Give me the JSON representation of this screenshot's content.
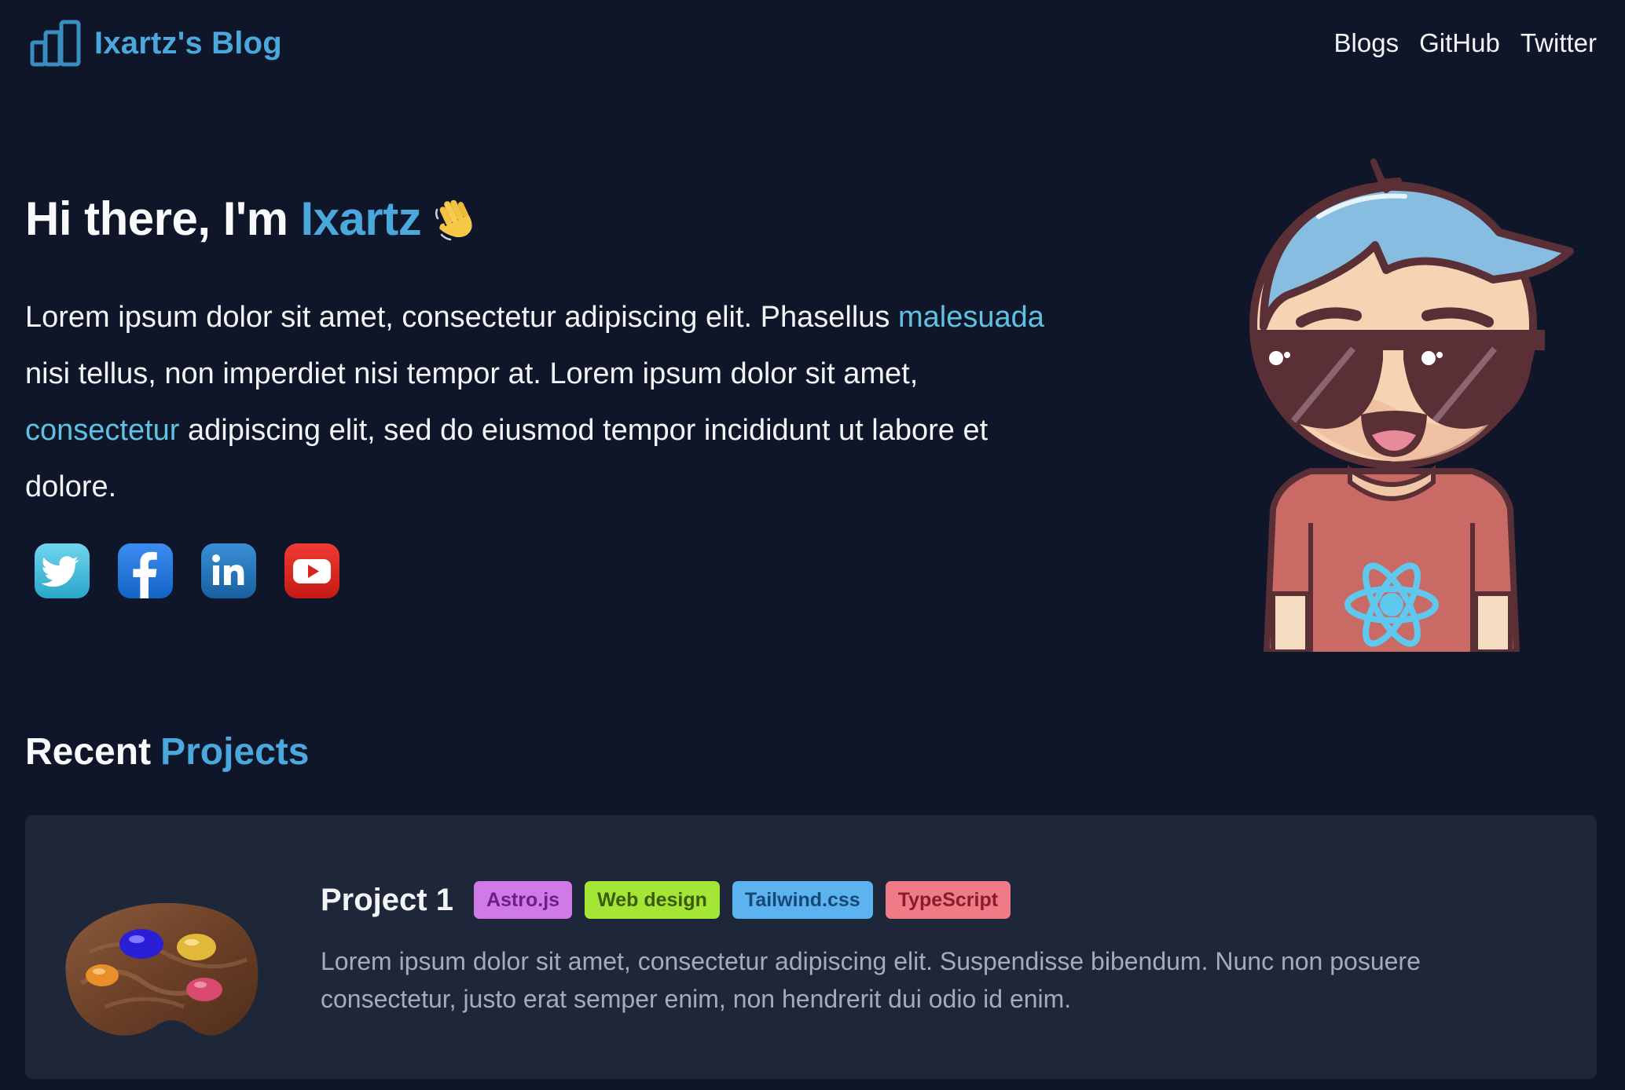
{
  "header": {
    "brand": "Ixartz's Blog",
    "nav": [
      {
        "label": "Blogs"
      },
      {
        "label": "GitHub"
      },
      {
        "label": "Twitter"
      }
    ]
  },
  "hero": {
    "greeting": "Hi there, I'm",
    "name": "Ixartz",
    "wave_icon": "waving-hand-icon",
    "paragraph": {
      "part1": "Lorem ipsum dolor sit amet, consectetur adipiscing elit. Phasellus ",
      "link1": "malesuada",
      "part2": " nisi tellus, non imperdiet nisi tempor at. Lorem ipsum dolor sit amet, ",
      "link2": "consectetur",
      "part3": " adipiscing elit, sed do eiusmod tempor incididunt ut labore et dolore."
    },
    "socials": [
      {
        "icon": "twitter-icon"
      },
      {
        "icon": "facebook-icon"
      },
      {
        "icon": "linkedin-icon"
      },
      {
        "icon": "youtube-icon"
      }
    ],
    "avatar_icon": "avatar-illustration"
  },
  "projects": {
    "title_part1": "Recent",
    "title_part2": "Projects",
    "items": [
      {
        "title": "Project 1",
        "image_icon": "paint-palette-icon",
        "tags": [
          {
            "label": "Astro.js",
            "bg": "#d07ae8",
            "fg": "#6b1f86"
          },
          {
            "label": "Web design",
            "bg": "#a3e635",
            "fg": "#3b5a0e"
          },
          {
            "label": "Tailwind.css",
            "bg": "#5cb3f0",
            "fg": "#164875"
          },
          {
            "label": "TypeScript",
            "bg": "#ef7b87",
            "fg": "#8a1b2b"
          }
        ],
        "description": "Lorem ipsum dolor sit amet, consectetur adipiscing elit. Suspendisse bibendum. Nunc non posuere consectetur, justo erat semper enim, non hendrerit dui odio id enim."
      }
    ]
  },
  "colors": {
    "background": "#0f1629",
    "card": "#1e2639",
    "accent": "#4ba8dc",
    "link": "#5ec2e2"
  }
}
